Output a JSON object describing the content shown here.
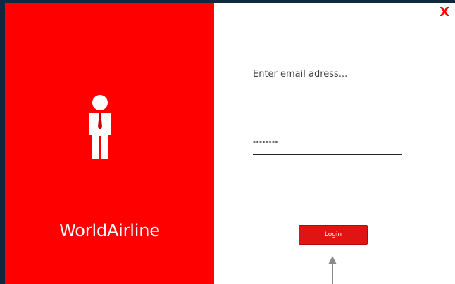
{
  "window": {
    "close_label": "X"
  },
  "brand": {
    "name": "WorldAirline",
    "icon": "businessman-icon"
  },
  "login_form": {
    "email_placeholder": "Enter email adress...",
    "password_value": "********",
    "login_label": "Login"
  },
  "colors": {
    "brand_red": "#ff0000",
    "button_red": "#e11414",
    "frame_background": "#0f2a3d"
  }
}
